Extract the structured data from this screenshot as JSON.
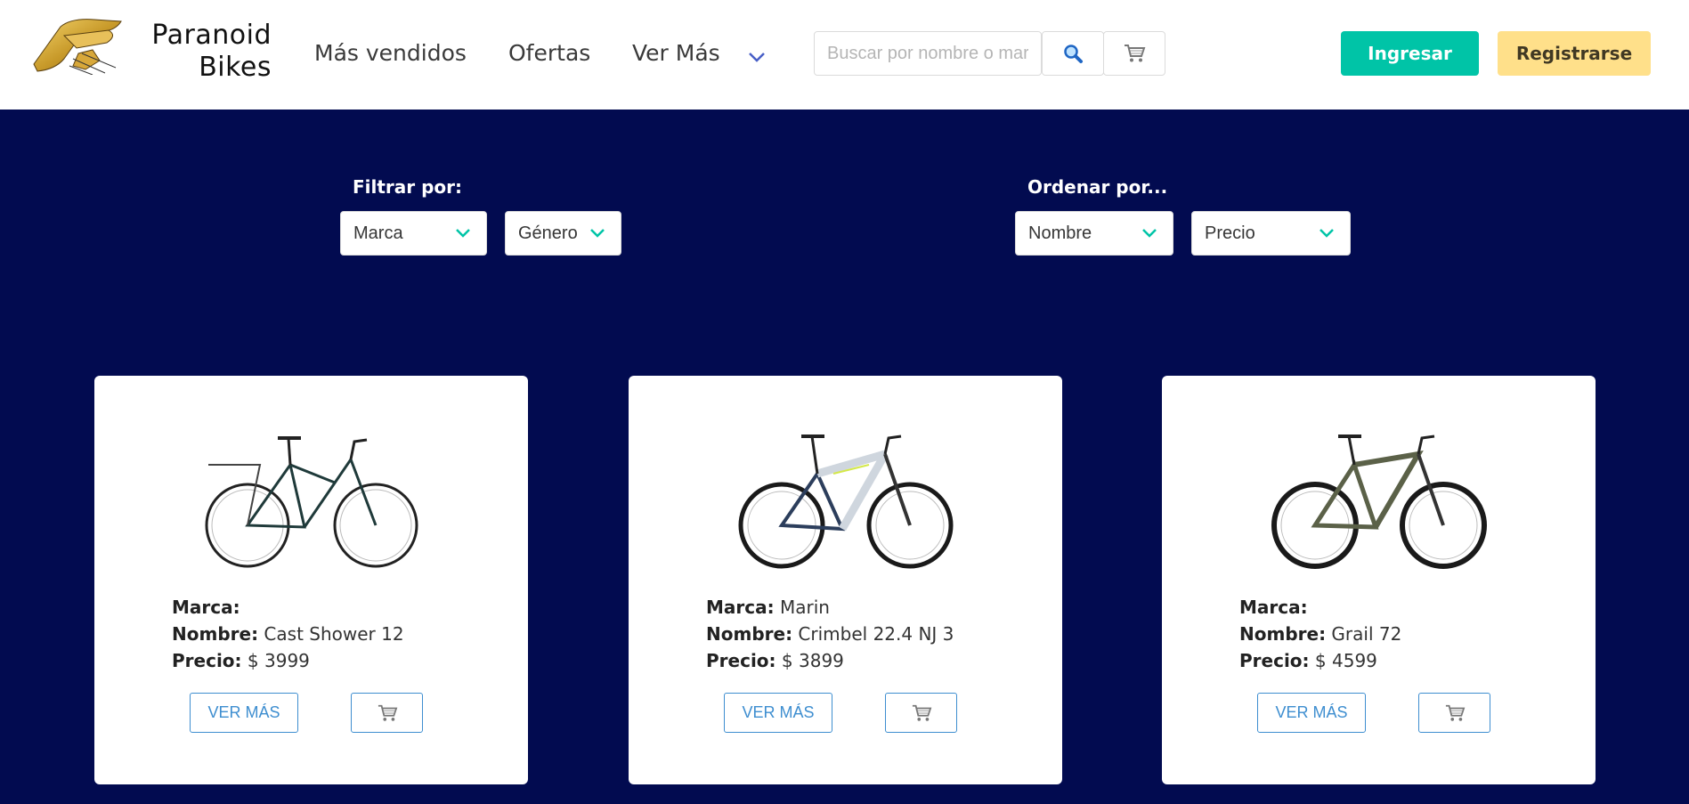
{
  "brand": {
    "line1": "Paranoid",
    "line2": "Bikes"
  },
  "nav": {
    "items": [
      "Más vendidos",
      "Ofertas",
      "Ver Más"
    ]
  },
  "search": {
    "placeholder": "Buscar por nombre o marca",
    "value": ""
  },
  "auth": {
    "login_label": "Ingresar",
    "register_label": "Registrarse"
  },
  "filters": {
    "filter_label": "Filtrar por:",
    "sort_label": "Ordenar por...",
    "brand_select": "Marca",
    "gender_select": "Género",
    "name_select": "Nombre",
    "price_select": "Precio"
  },
  "labels": {
    "marca": "Marca:",
    "nombre": "Nombre:",
    "precio": "Precio:",
    "ver_mas": "VER MÁS"
  },
  "products": [
    {
      "marca": "",
      "nombre": "Cast Shower 12",
      "precio": "$ 3999"
    },
    {
      "marca": "Marin",
      "nombre": "Crimbel 22.4 NJ 3",
      "precio": "$ 3899"
    },
    {
      "marca": "",
      "nombre": "Grail 72",
      "precio": "$ 4599"
    }
  ],
  "colors": {
    "page_background": "#020b50",
    "header_background": "#ffffff",
    "primary": "#00c4a7",
    "warning": "#ffe08a",
    "link": "#3e8ed0"
  },
  "icons": [
    "logo",
    "chevron-down-icon",
    "search-icon",
    "cart-icon"
  ]
}
